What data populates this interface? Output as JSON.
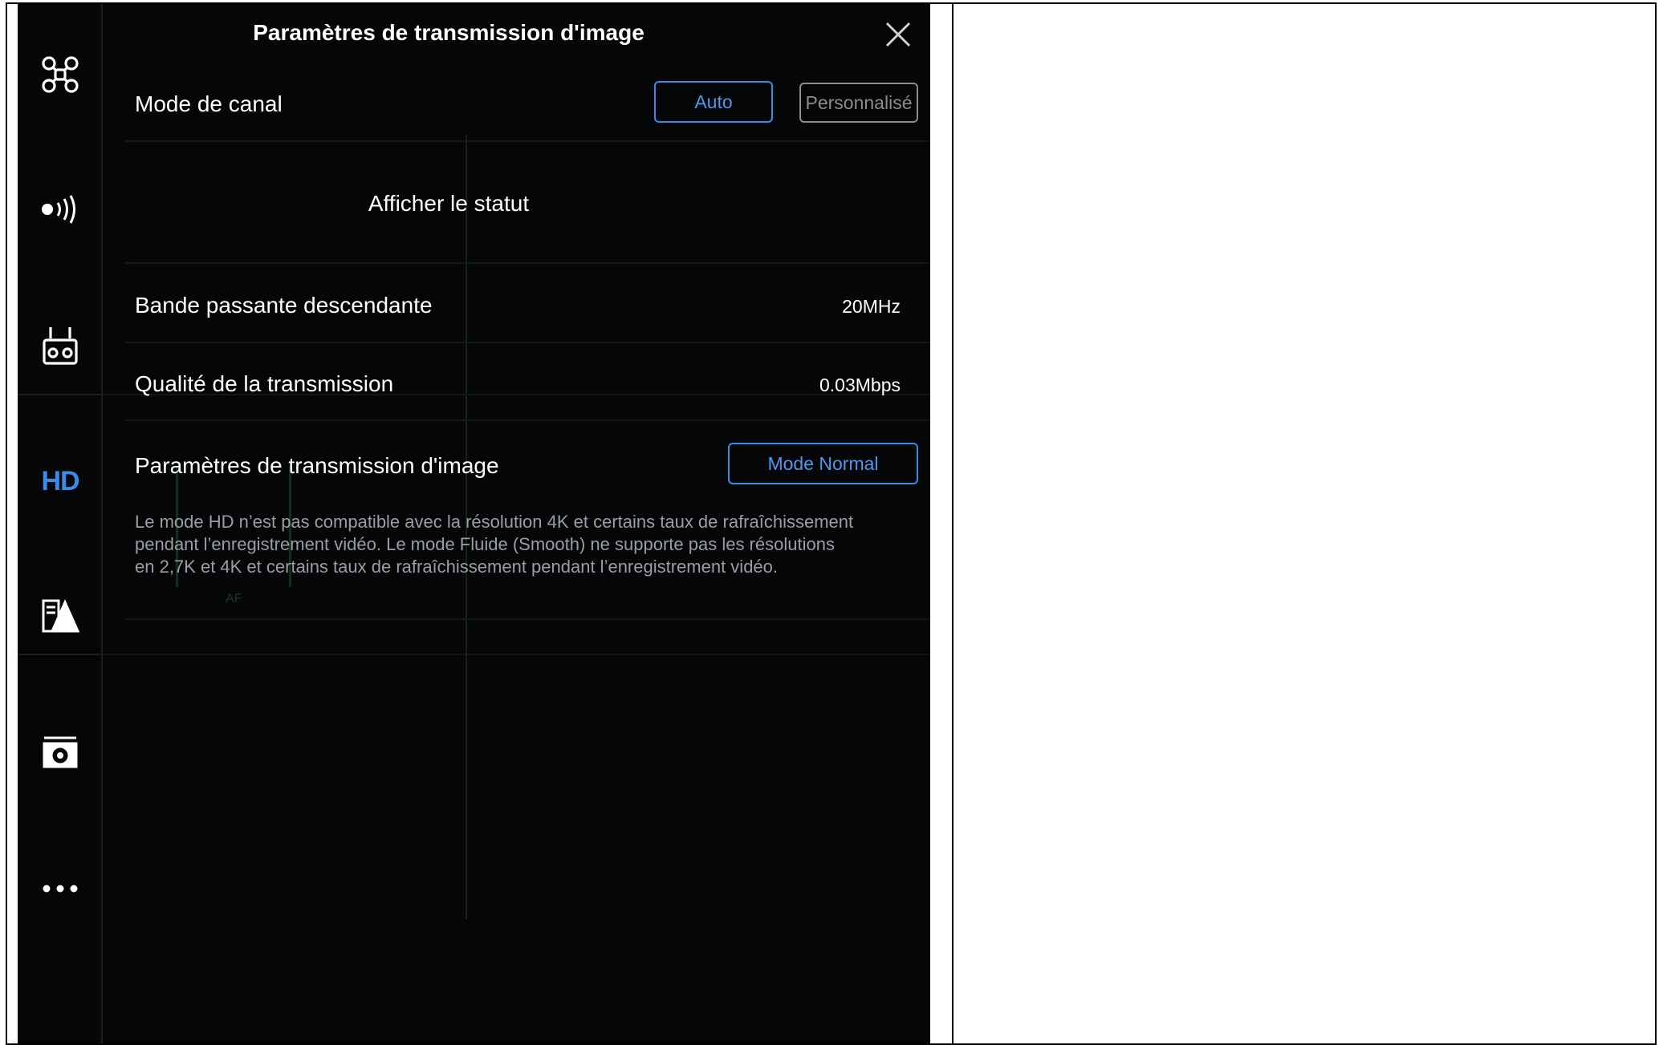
{
  "panel": {
    "title": "Paramètres de transmission d'image",
    "channel_mode": {
      "label": "Mode de canal",
      "options": [
        "Auto",
        "Personnalisé"
      ],
      "selected": "Auto"
    },
    "status_link": "Afficher le statut",
    "downlink_bandwidth": {
      "label": "Bande passante descendante",
      "value": "20MHz"
    },
    "transmission_quality": {
      "label": "Qualité de la transmission",
      "value": "0.03Mbps"
    },
    "image_transmission": {
      "label": "Paramètres de transmission d'image",
      "mode_button": "Mode Normal",
      "description": "Le mode HD n’est pas compatible avec la résolution 4K et certains taux de rafraîchissement pendant l’enregistrement vidéo. Le mode Fluide (Smooth) ne supporte pas les résolutions en 2,7K et 4K et certains taux de rafraîchissement pendant l’enregistrement vidéo."
    }
  },
  "sidebar": {
    "items": [
      {
        "icon": "aircraft-icon"
      },
      {
        "icon": "signal-icon"
      },
      {
        "icon": "remote-controller-icon"
      },
      {
        "icon": "hd-icon",
        "label": "HD",
        "active": true
      },
      {
        "icon": "map-layers-icon"
      },
      {
        "icon": "camera-icon"
      },
      {
        "icon": "more-icon"
      }
    ]
  },
  "overlay": {
    "af_label": "AF"
  },
  "colors": {
    "accent": "#3b8ce6",
    "background": "#050607",
    "text": "#ffffff",
    "muted": "#9a9ea3"
  }
}
